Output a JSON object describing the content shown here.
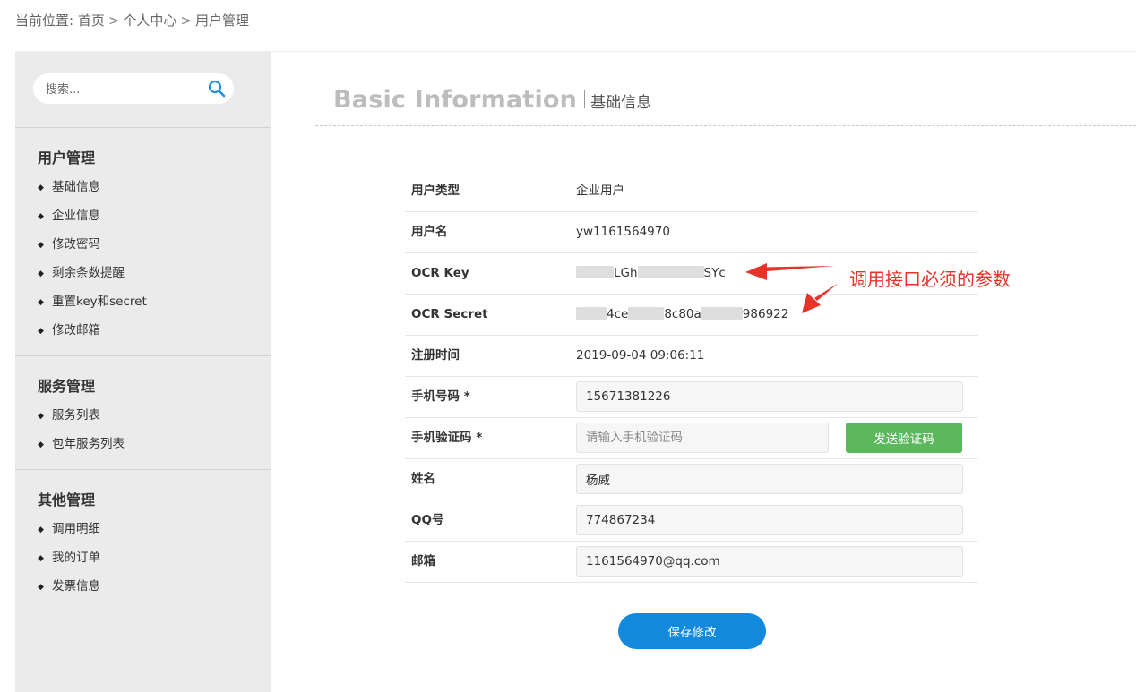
{
  "breadcrumb": {
    "prefix": "当前位置: ",
    "items": [
      "首页",
      "个人中心",
      "用户管理"
    ],
    "separator": ">"
  },
  "sidebar": {
    "search": {
      "placeholder": "搜索..."
    },
    "groups": [
      {
        "title": "用户管理",
        "items": [
          "基础信息",
          "企业信息",
          "修改密码",
          "剩余条数提醒",
          "重置key和secret",
          "修改邮箱"
        ]
      },
      {
        "title": "服务管理",
        "items": [
          "服务列表",
          "包年服务列表"
        ]
      },
      {
        "title": "其他管理",
        "items": [
          "调用明细",
          "我的订单",
          "发票信息"
        ]
      }
    ]
  },
  "main": {
    "title_en": "Basic Information",
    "title_zh": "基础信息",
    "rows": {
      "user_type": {
        "label": "用户类型",
        "value": "企业用户"
      },
      "username": {
        "label": "用户名",
        "value": "yw1161564970"
      },
      "ocr_key": {
        "label": "OCR Key",
        "parts": [
          "LGh",
          "SYc"
        ]
      },
      "ocr_secret": {
        "label": "OCR Secret",
        "parts": [
          "4ce",
          "8c80a",
          "986922"
        ]
      },
      "reg_time": {
        "label": "注册时间",
        "value": "2019-09-04 09:06:11"
      },
      "phone": {
        "label": "手机号码 *",
        "value": "15671381226"
      },
      "code": {
        "label": "手机验证码 *",
        "placeholder": "请输入手机验证码",
        "button": "发送验证码"
      },
      "name": {
        "label": "姓名",
        "value": "杨威"
      },
      "qq": {
        "label": "QQ号",
        "value": "774867234"
      },
      "email": {
        "label": "邮箱",
        "value": "1161564970@qq.com"
      }
    },
    "save_button": "保存修改"
  },
  "annotation": {
    "text": "调用接口必须的参数",
    "color": "#e8332a"
  },
  "colors": {
    "sidebar_bg": "#ebebeb",
    "send_button": "#5cb85c",
    "save_button": "#1389dd",
    "title_en": "#bdbdbd"
  },
  "icons": {
    "search": "search-icon"
  }
}
